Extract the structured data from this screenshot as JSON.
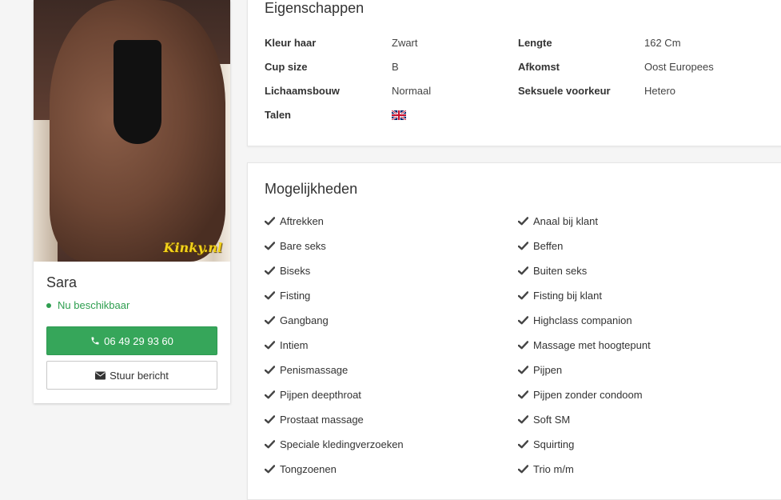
{
  "profile": {
    "name": "Sara",
    "status": "Nu beschikbaar",
    "phone_label": "06 49 29 93 60",
    "message_label": "Stuur bericht",
    "watermark": "Kinky.nl"
  },
  "properties": {
    "title": "Eigenschappen",
    "rows": [
      {
        "label": "Kleur haar",
        "value": "Zwart"
      },
      {
        "label": "Cup size",
        "value": "B"
      },
      {
        "label": "Lichaamsbouw",
        "value": "Normaal"
      },
      {
        "label": "Talen",
        "value": ""
      },
      {
        "label": "Lengte",
        "value": "162 Cm"
      },
      {
        "label": "Afkomst",
        "value": "Oost Europees"
      },
      {
        "label": "Seksuele voorkeur",
        "value": "Hetero"
      }
    ],
    "language_flag": "uk-flag-icon"
  },
  "options": {
    "title": "Mogelijkheden",
    "left": [
      "Aftrekken",
      "Bare seks",
      "Biseks",
      "Fisting",
      "Gangbang",
      "Intiem",
      "Penismassage",
      "Pijpen deepthroat",
      "Prostaat massage",
      "Speciale kledingverzoeken",
      "Tongzoenen"
    ],
    "right": [
      "Anaal bij klant",
      "Beffen",
      "Buiten seks",
      "Fisting bij klant",
      "Highclass companion",
      "Massage met hoogtepunt",
      "Pijpen",
      "Pijpen zonder condoom",
      "Soft SM",
      "Squirting",
      "Trio m/m"
    ]
  },
  "colors": {
    "accent_green": "#36a65a",
    "status_green": "#2e9e4f",
    "check_color": "#444444"
  }
}
